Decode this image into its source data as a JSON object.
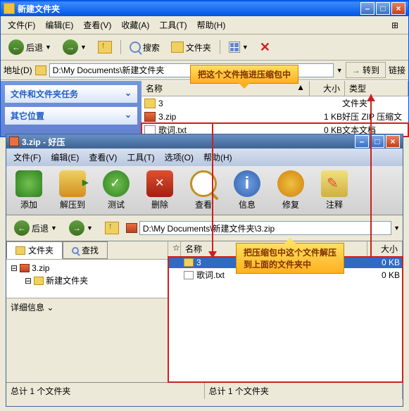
{
  "win1": {
    "title": "新建文件夹",
    "menu": [
      "文件(F)",
      "编辑(E)",
      "查看(V)",
      "收藏(A)",
      "工具(T)",
      "帮助(H)"
    ],
    "back": "后退",
    "search": "搜索",
    "folders": "文件夹",
    "addr_label": "地址(D)",
    "address": "D:\\My Documents\\新建文件夹",
    "go": "转到",
    "links": "链接",
    "task1": "文件和文件夹任务",
    "task2": "其它位置",
    "hdr_name": "名称",
    "hdr_size": "大小",
    "hdr_type": "类型",
    "files": [
      {
        "name": "3",
        "size": "",
        "type": "文件夹",
        "icon": "folder"
      },
      {
        "name": "3.zip",
        "size": "1 KB",
        "type": "好压 ZIP 压缩文",
        "icon": "zip"
      },
      {
        "name": "歌词.txt",
        "size": "0 KB",
        "type": "文本文档",
        "icon": "txt"
      }
    ]
  },
  "callout1": "把这个文件拖进压缩包中",
  "callout2a": "把压缩包中这个文件解压",
  "callout2b": "到上面的文件夹中",
  "win2": {
    "title": "3.zip - 好压",
    "menu": [
      "文件(F)",
      "编辑(E)",
      "查看(V)",
      "工具(T)",
      "选项(O)",
      "帮助(H)"
    ],
    "tools": [
      "添加",
      "解压到",
      "测试",
      "删除",
      "查看",
      "信息",
      "修复",
      "注释"
    ],
    "back": "后退",
    "path": "D:\\My Documents\\新建文件夹\\3.zip",
    "tab_folders": "文件夹",
    "tab_search": "查找",
    "tree_root": "3.zip",
    "tree_child": "新建文件夹",
    "detail_label": "详细信息",
    "hdr_name": "名称",
    "hdr_size": "大小",
    "files": [
      {
        "name": "3",
        "size": "0 KB",
        "icon": "folder",
        "sel": true
      },
      {
        "name": "歌词.txt",
        "size": "0 KB",
        "icon": "txt",
        "sel": false
      }
    ],
    "status_l": "总计 1 个文件夹",
    "status_r": "总计 1 个文件夹"
  }
}
